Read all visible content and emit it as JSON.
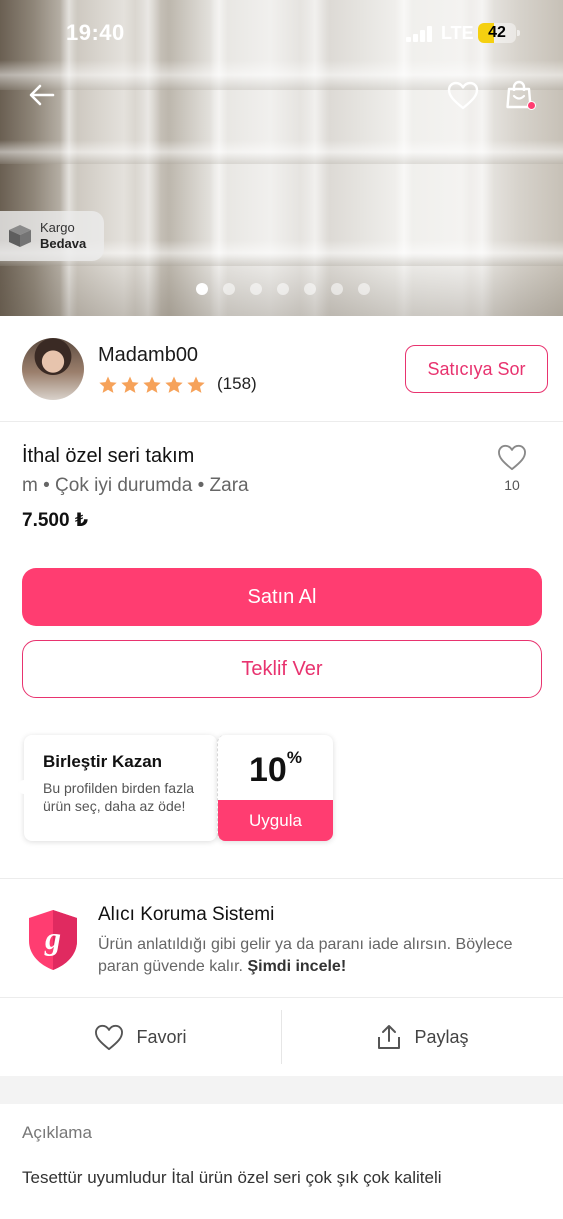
{
  "status_bar": {
    "time": "19:40",
    "network": "LTE",
    "battery": "42",
    "battery_level": 0.42
  },
  "hero": {
    "cargo_line1": "Kargo",
    "cargo_line2": "Bedava",
    "image_count": 7,
    "active_index": 0
  },
  "seller": {
    "name": "Madamb00",
    "rating": 5,
    "rating_count": "(158)",
    "ask_label": "Satıcıya Sor"
  },
  "product": {
    "title": "İthal özel seri takım",
    "meta": "m • Çok iyi durumda • Zara",
    "price": "7.500 ₺",
    "like_count": "10"
  },
  "buttons": {
    "buy": "Satın Al",
    "offer": "Teklif Ver"
  },
  "coupon": {
    "title": "Birleştir Kazan",
    "description": "Bu profilden birden fazla ürün seç, daha az öde!",
    "percent": "10",
    "percent_sign": "%",
    "apply": "Uygula"
  },
  "protection": {
    "title": "Alıcı Koruma Sistemi",
    "description": "Ürün anlatıldığı gibi gelir ya da paranı iade alırsın. Böylece paran güvende kalır.",
    "link": "Şimdi incele!"
  },
  "actions": {
    "favorite": "Favori",
    "share": "Paylaş"
  },
  "description": {
    "label": "Açıklama",
    "text": "Tesettür uyumludur İtal ürün özel seri çok şık çok kaliteli"
  },
  "colors": {
    "accent": "#ff3d71",
    "accent_text": "#e8336f",
    "star": "#f6a25a",
    "text": "#1a1a1a",
    "muted": "#666666"
  },
  "icons": [
    "back-arrow-icon",
    "heart-icon",
    "shopping-bag-icon",
    "cargo-box-icon",
    "star-icon",
    "shield-icon",
    "share-icon"
  ]
}
